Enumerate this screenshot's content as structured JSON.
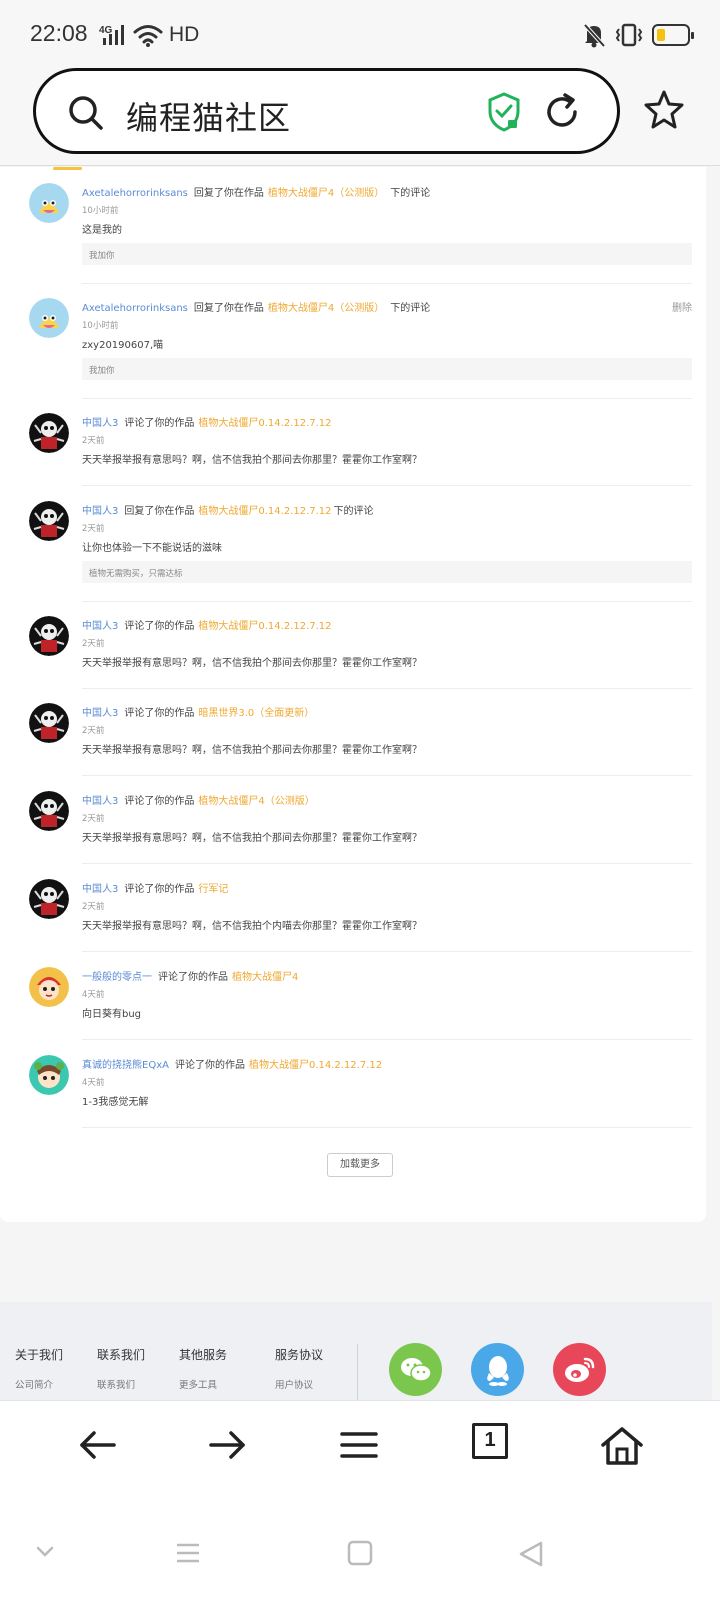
{
  "status_bar": {
    "time": "22:08",
    "network_label": "4G",
    "hd_label": "HD",
    "battery_level": 0.3,
    "battery_color": "#f4c20d",
    "icons": [
      "4g-signal-icon",
      "wifi-icon",
      "mute-bell-icon",
      "vibrate-icon",
      "battery-icon"
    ]
  },
  "browser": {
    "url_text": "编程猫社区",
    "icons": [
      "search-icon",
      "shield-check-icon",
      "refresh-icon",
      "star-icon"
    ],
    "shield_color": "#21b35a"
  },
  "colors": {
    "username": "#5b8bd5",
    "work_link": "#f0a830",
    "accent": "#f9c23c"
  },
  "comments": [
    {
      "user": "Axetalehorrorinksans",
      "action": "回复了你在作品",
      "work": "植物大战僵尸4（公测版）",
      "tail": "下的评论",
      "time": "10小时前",
      "text": "这是我的",
      "quote": "我加你",
      "delete": ""
    },
    {
      "user": "Axetalehorrorinksans",
      "action": "回复了你在作品",
      "work": "植物大战僵尸4（公测版）",
      "tail": "下的评论",
      "time": "10小时前",
      "text": "zxy20190607,喵",
      "quote": "我加你",
      "delete": "删除"
    },
    {
      "user": "中国人3",
      "action": "评论了你的作品",
      "work": "植物大战僵尸0.14.2.12.7.12",
      "tail": "",
      "time": "2天前",
      "text": "天天举报举报有意思吗？啊，信不信我拍个那间去你那里？霍霍你工作室啊？",
      "quote": "",
      "delete": ""
    },
    {
      "user": "中国人3",
      "action": "回复了你在作品",
      "work": "植物大战僵尸0.14.2.12.7.12",
      "tail": "下的评论",
      "time": "2天前",
      "text": "让你也体验一下不能说话的滋味",
      "quote": "植物无需购买，只需达标",
      "delete": ""
    },
    {
      "user": "中国人3",
      "action": "评论了你的作品",
      "work": "植物大战僵尸0.14.2.12.7.12",
      "tail": "",
      "time": "2天前",
      "text": "天天举报举报有意思吗？啊，信不信我拍个那间去你那里？霍霍你工作室啊？",
      "quote": "",
      "delete": ""
    },
    {
      "user": "中国人3",
      "action": "评论了你的作品",
      "work": "暗黑世界3.0（全面更新）",
      "tail": "",
      "time": "2天前",
      "text": "天天举报举报有意思吗？啊，信不信我拍个那间去你那里？霍霍你工作室啊？",
      "quote": "",
      "delete": ""
    },
    {
      "user": "中国人3",
      "action": "评论了你的作品",
      "work": "植物大战僵尸4（公测版）",
      "tail": "",
      "time": "2天前",
      "text": "天天举报举报有意思吗？啊，信不信我拍个那间去你那里？霍霍你工作室啊？",
      "quote": "",
      "delete": ""
    },
    {
      "user": "中国人3",
      "action": "评论了你的作品",
      "work": "行军记",
      "tail": "",
      "time": "2天前",
      "text": "天天举报举报有意思吗？啊，信不信我拍个内喵去你那里？霍霍你工作室啊？",
      "quote": "",
      "delete": ""
    },
    {
      "user": "一般般的零点一",
      "action": "评论了你的作品",
      "work": "植物大战僵尸4",
      "tail": "",
      "time": "4天前",
      "text": "向日葵有bug",
      "quote": "",
      "delete": ""
    },
    {
      "user": "真诚的挠挠熊EQxA",
      "action": "评论了你的作品",
      "work": "植物大战僵尸0.14.2.12.7.12",
      "tail": "",
      "time": "4天前",
      "text": "1-3我感觉无解",
      "quote": "",
      "delete": ""
    }
  ],
  "load_more": "加载更多",
  "footer": {
    "columns": [
      {
        "title": "关于我们",
        "link": "公司简介"
      },
      {
        "title": "联系我们",
        "link": "联系我们"
      },
      {
        "title": "其他服务",
        "link": "更多工具"
      },
      {
        "title": "服务协议",
        "link": "用户协议"
      }
    ],
    "social": [
      {
        "name": "wechat-icon",
        "color": "#7bc74d"
      },
      {
        "name": "qq-icon",
        "color": "#4aa8e8"
      },
      {
        "name": "weibo-icon",
        "color": "#e8475a"
      }
    ]
  },
  "bottom_nav": {
    "tab_count": "1",
    "icons": [
      "back-arrow-icon",
      "forward-arrow-icon",
      "menu-icon",
      "tabs-icon",
      "home-icon"
    ]
  },
  "system_nav": {
    "icons": [
      "chevron-down-icon",
      "recents-icon",
      "home-square-icon",
      "back-triangle-icon"
    ]
  }
}
